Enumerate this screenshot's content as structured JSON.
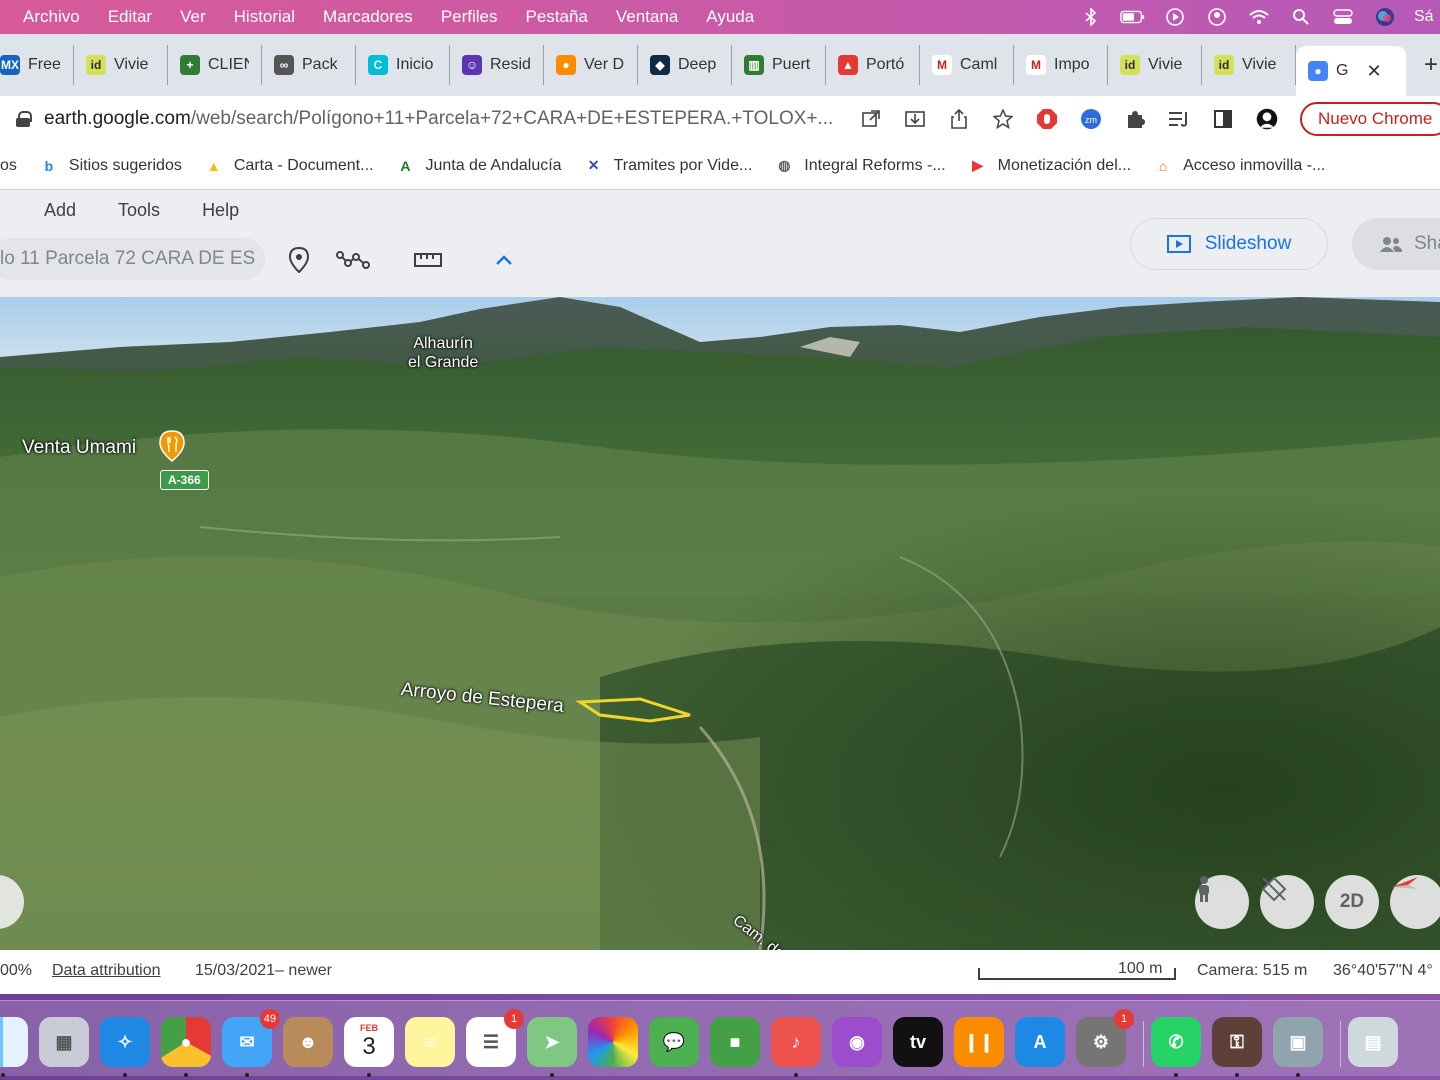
{
  "menubar": {
    "items": [
      "Archivo",
      "Editar",
      "Ver",
      "Historial",
      "Marcadores",
      "Perfiles",
      "Pestaña",
      "Ventana",
      "Ayuda"
    ],
    "user_short": "Sá"
  },
  "tabs": [
    {
      "label": "Free",
      "icon": "mx-icon",
      "color": "#1565c0",
      "glyph": "MX"
    },
    {
      "label": "Vivie",
      "icon": "idealista-icon",
      "color": "#d4e157",
      "glyph": "id"
    },
    {
      "label": "CLIEN",
      "icon": "plus-icon",
      "color": "#2e7d32",
      "glyph": "+"
    },
    {
      "label": "Pack",
      "icon": "pack-icon",
      "color": "#555555",
      "glyph": "∞"
    },
    {
      "label": "Inicio",
      "icon": "canva-icon",
      "color": "#00bcd4",
      "glyph": "C"
    },
    {
      "label": "Resid",
      "icon": "chat-icon",
      "color": "#5e35b1",
      "glyph": "☺"
    },
    {
      "label": "Ver D",
      "icon": "orange-icon",
      "color": "#fb8c00",
      "glyph": "●"
    },
    {
      "label": "Deep",
      "icon": "deepl-icon",
      "color": "#0d2b45",
      "glyph": "◆"
    },
    {
      "label": "Puert",
      "icon": "bars-icon",
      "color": "#2e7d32",
      "glyph": "▥"
    },
    {
      "label": "Portó",
      "icon": "cap-icon",
      "color": "#e53935",
      "glyph": "▲"
    },
    {
      "label": "Caml",
      "icon": "gmail-icon",
      "color": "#ffffff",
      "glyph": "M"
    },
    {
      "label": "Impo",
      "icon": "gmail-icon",
      "color": "#ffffff",
      "glyph": "M"
    },
    {
      "label": "Vivie",
      "icon": "idealista-icon",
      "color": "#d4e157",
      "glyph": "id"
    },
    {
      "label": "Vivie",
      "icon": "idealista-icon",
      "color": "#d4e157",
      "glyph": "id"
    },
    {
      "label": "G",
      "icon": "earth-icon",
      "color": "#4285f4",
      "glyph": "●",
      "active": true
    }
  ],
  "address": {
    "host": "earth.google.com",
    "path": "/web/search/Polígono+11+Parcela+72+CARA+DE+ESTEPERA.+TOLOX+..."
  },
  "toolbar": {
    "chrome_button": "Nuevo Chrome"
  },
  "bookmarks": [
    {
      "label": "os",
      "icon": ""
    },
    {
      "label": "Sitios sugeridos",
      "icon": "bing-icon"
    },
    {
      "label": "Carta - Document...",
      "icon": "drive-icon"
    },
    {
      "label": "Junta de Andalucía",
      "icon": "junta-icon"
    },
    {
      "label": "Tramites por Vide...",
      "icon": "x-icon"
    },
    {
      "label": "Integral Reforms -...",
      "icon": "globe-icon"
    },
    {
      "label": "Monetización del...",
      "icon": "youtube-icon"
    },
    {
      "label": "Acceso inmovilla -...",
      "icon": "inmovilla-icon"
    }
  ],
  "earth": {
    "menu": [
      "Add",
      "Tools",
      "Help"
    ],
    "search_text": "lo 11 Parcela 72 CARA DE ES",
    "slideshow_label": "Slideshow",
    "share_label": "Sha"
  },
  "map": {
    "labels": {
      "town": "Alhaurín\nel Grande",
      "poi": "Venta Umami",
      "road": "A-366",
      "stream": "Arroyo de Estepera",
      "path": "Cam. de Estepera"
    },
    "controls": {
      "view_2d": "2D"
    },
    "highlight_color": "#f2d52b"
  },
  "status": {
    "zoom": "00%",
    "attribution": "Data attribution",
    "imagery_date": "15/03/2021– newer",
    "scale": "100 m",
    "camera": "Camera: 515 m",
    "coords": "36°40'57\"N 4°"
  },
  "dock": {
    "apps": [
      {
        "name": "finder",
        "badge": ""
      },
      {
        "name": "launchpad",
        "badge": ""
      },
      {
        "name": "safari",
        "badge": ""
      },
      {
        "name": "chrome",
        "badge": ""
      },
      {
        "name": "mail",
        "badge": "49"
      },
      {
        "name": "contacts",
        "badge": ""
      },
      {
        "name": "calendar",
        "badge": "",
        "month": "FEB",
        "day": "3"
      },
      {
        "name": "notes",
        "badge": ""
      },
      {
        "name": "reminders",
        "badge": "1"
      },
      {
        "name": "maps",
        "badge": ""
      },
      {
        "name": "photos",
        "badge": ""
      },
      {
        "name": "messages",
        "badge": ""
      },
      {
        "name": "facetime",
        "badge": ""
      },
      {
        "name": "music",
        "badge": ""
      },
      {
        "name": "podcasts",
        "badge": ""
      },
      {
        "name": "apple-tv",
        "badge": "",
        "text": "tv"
      },
      {
        "name": "books",
        "badge": ""
      },
      {
        "name": "app-store",
        "badge": ""
      },
      {
        "name": "system-preferences",
        "badge": "1"
      },
      {
        "name": "whatsapp",
        "badge": ""
      },
      {
        "name": "keychain",
        "badge": ""
      },
      {
        "name": "preview",
        "badge": ""
      },
      {
        "name": "screenshot",
        "badge": ""
      }
    ]
  }
}
